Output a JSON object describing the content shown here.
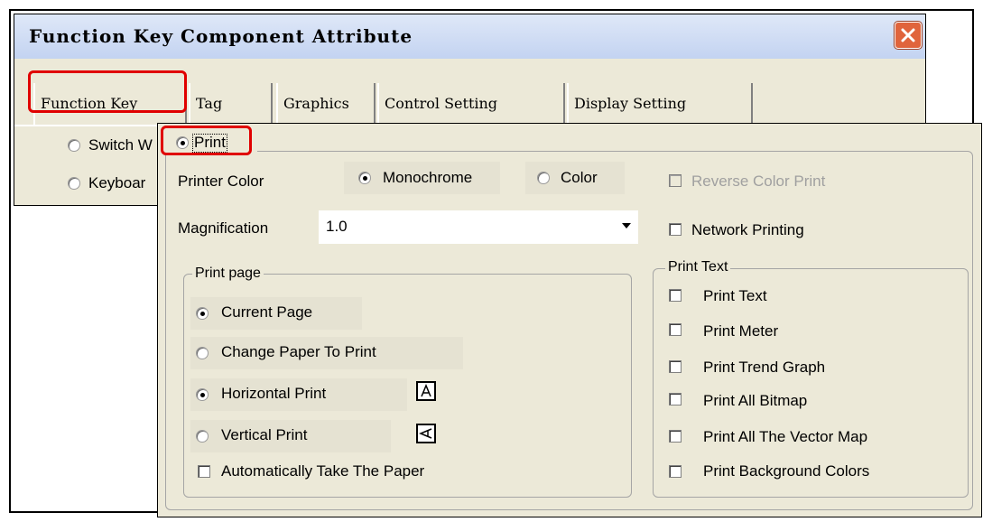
{
  "window": {
    "title": "Function Key Component Attribute",
    "close_icon": "close-icon"
  },
  "tabs": [
    {
      "label": "Function Key"
    },
    {
      "label": "Tag"
    },
    {
      "label": "Graphics"
    },
    {
      "label": "Control Setting"
    },
    {
      "label": "Display Setting"
    }
  ],
  "under_options": {
    "switch": "Switch W",
    "keyboard": "Keyboar"
  },
  "print": {
    "label": "Print",
    "selected": true,
    "printer_color_label": "Printer Color",
    "monochrome": "Monochrome",
    "color": "Color",
    "reverse_color_print": "Reverse Color Print",
    "magnification_label": "Magnification",
    "magnification_value": "1.0",
    "network_printing": "Network Printing",
    "print_page_legend": "Print page",
    "current_page": "Current Page",
    "change_paper": "Change Paper To Print",
    "horizontal_print": "Horizontal Print",
    "vertical_print": "Vertical Print",
    "auto_take_paper": "Automatically Take The Paper",
    "print_text_legend": "Print Text",
    "print_text_items": [
      "Print Text",
      "Print Meter",
      "Print Trend Graph",
      "Print All Bitmap",
      "Print All The Vector Map",
      "Print Background Colors"
    ]
  },
  "colors": {
    "highlight": "#e00000",
    "dialog_bg": "#ece9d8"
  }
}
